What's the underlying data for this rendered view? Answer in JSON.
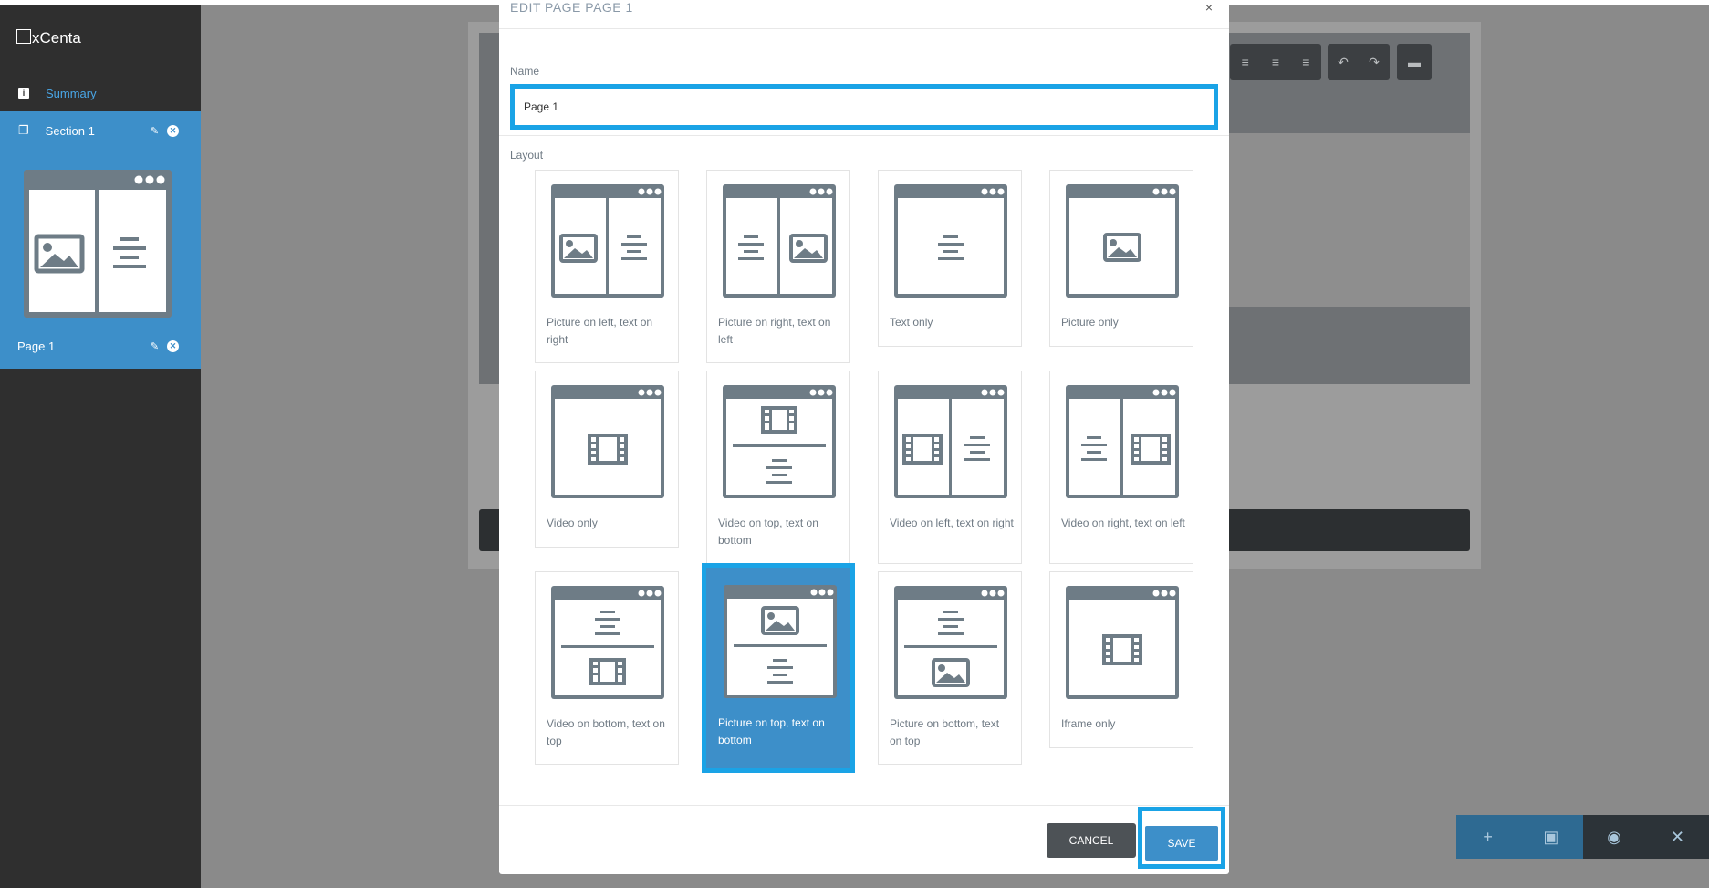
{
  "app": {
    "logo": "xCenta"
  },
  "sidebar": {
    "summary_label": "Summary",
    "section_label": "Section 1",
    "page_label": "Page 1"
  },
  "modal": {
    "title": "EDIT PAGE PAGE 1",
    "close": "×",
    "name_label": "Name",
    "name_value": "Page 1",
    "layout_label": "Layout",
    "layouts": [
      {
        "caption": "Picture on left, text on right",
        "selected": false
      },
      {
        "caption": "Picture on right, text on left",
        "selected": false
      },
      {
        "caption": "Text only",
        "selected": false
      },
      {
        "caption": "Picture only",
        "selected": false
      },
      {
        "caption": "Video only",
        "selected": false
      },
      {
        "caption": "Video on top, text on bottom",
        "selected": false
      },
      {
        "caption": "Video on left, text on right",
        "selected": false
      },
      {
        "caption": "Video on right, text on left",
        "selected": false
      },
      {
        "caption": "Video on bottom, text on top",
        "selected": false
      },
      {
        "caption": "Picture on top, text on bottom",
        "selected": true
      },
      {
        "caption": "Picture on bottom, text on top",
        "selected": false
      },
      {
        "caption": "Iframe only",
        "selected": false
      }
    ],
    "cancel_label": "CANCEL",
    "save_label": "SAVE"
  },
  "colors": {
    "accent": "#3d8fc9",
    "highlight": "#1aa3e6",
    "sidebar_bg": "#2f2f2f",
    "layout_icon": "#6e7c86"
  }
}
